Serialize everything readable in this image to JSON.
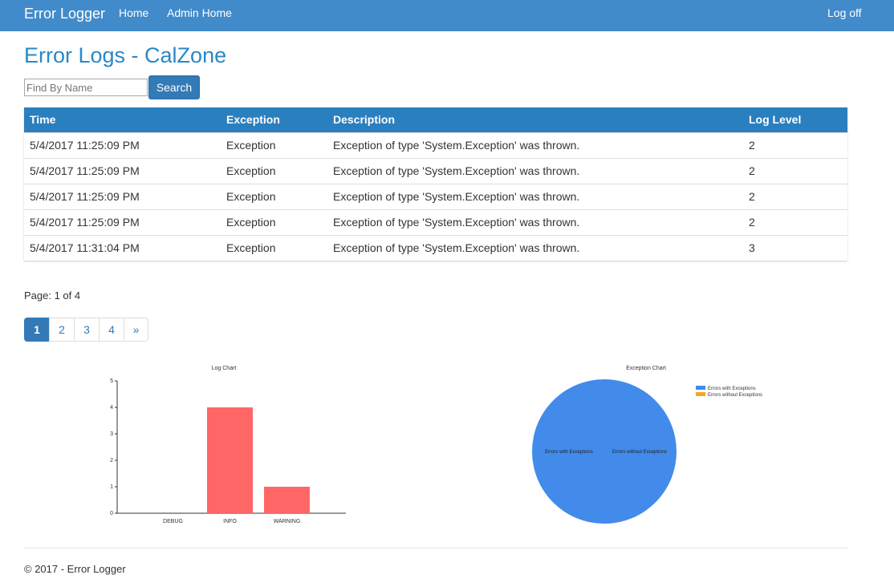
{
  "navbar": {
    "brand": "Error Logger",
    "links": [
      "Home",
      "Admin Home"
    ],
    "logoff": "Log off"
  },
  "page_title": "Error Logs - CalZone",
  "search": {
    "placeholder": "Find By Name",
    "button": "Search"
  },
  "table": {
    "headers": [
      "Time",
      "Exception",
      "Description",
      "Log Level"
    ],
    "rows": [
      [
        "5/4/2017 11:25:09 PM",
        "Exception",
        "Exception of type 'System.Exception' was thrown.",
        "2"
      ],
      [
        "5/4/2017 11:25:09 PM",
        "Exception",
        "Exception of type 'System.Exception' was thrown.",
        "2"
      ],
      [
        "5/4/2017 11:25:09 PM",
        "Exception",
        "Exception of type 'System.Exception' was thrown.",
        "2"
      ],
      [
        "5/4/2017 11:25:09 PM",
        "Exception",
        "Exception of type 'System.Exception' was thrown.",
        "2"
      ],
      [
        "5/4/2017 11:31:04 PM",
        "Exception",
        "Exception of type 'System.Exception' was thrown.",
        "3"
      ]
    ]
  },
  "page_info": "Page: 1 of 4",
  "pagination": {
    "pages": [
      "1",
      "2",
      "3",
      "4"
    ],
    "next": "»",
    "current": "1"
  },
  "chart_data": [
    {
      "type": "bar",
      "title": "Log Chart",
      "categories": [
        "DEBUG",
        "INFO",
        "WARNING"
      ],
      "values": [
        0,
        4,
        1
      ],
      "ylim": [
        0,
        5
      ],
      "yticks": [
        "0",
        "1",
        "2",
        "3",
        "4",
        "5"
      ],
      "color": "#ff6666"
    },
    {
      "type": "pie",
      "title": "Exception Chart",
      "labels": [
        "Errors with Exceptions",
        "Errors without Exceptions"
      ],
      "values": [
        5,
        0
      ],
      "colors": [
        "#428bea",
        "#f5a623"
      ],
      "legend": "top-right"
    }
  ],
  "footer": "© 2017 - Error Logger"
}
